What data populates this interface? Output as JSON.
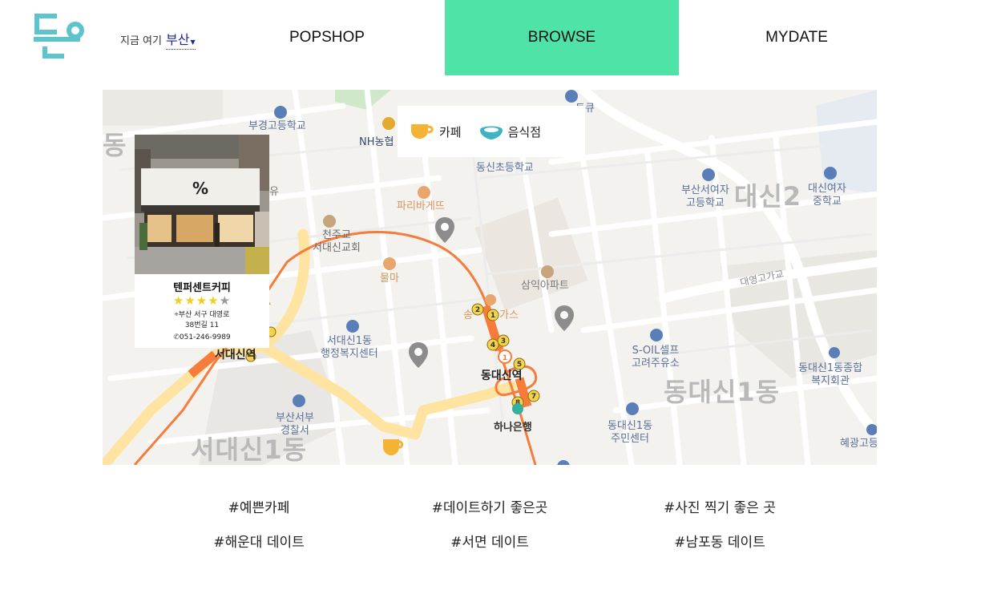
{
  "header": {
    "location_label": "지금 여기",
    "location_city": "부산",
    "nav": {
      "popshop": "POPSHOP",
      "browse": "BROWSE",
      "mydate": "MYDATE"
    },
    "active_tab": "BROWSE",
    "accent_color": "#4fe3a8",
    "logo_color": "#5cc4cc"
  },
  "map": {
    "legend": {
      "cafe": {
        "label": "카페",
        "icon": "coffee-cup-icon",
        "color": "#f5b335"
      },
      "restaurant": {
        "label": "음식점",
        "icon": "dish-icon",
        "color": "#3fb3c4"
      }
    },
    "labels": {
      "school_busan_girls": "부경고등학교",
      "nh": "NH농협",
      "dongsin_elem": "동신초등학교",
      "paris": "파리바게뜨",
      "catholic_1": "천주교",
      "catholic_2": "서대신교회",
      "mulma": "물마",
      "samik": "삼익아파트",
      "seodaesin_office_1": "서대신1동",
      "seodaesin_office_2": "행정복지센터",
      "police_1": "부산서부",
      "police_2": "경찰서",
      "hana": "하나은행",
      "soil_1": "S-OIL셀프",
      "soil_2": "고려주유소",
      "dongdaesin_center_1": "동대신1동",
      "dongdaesin_center_2": "주민센터",
      "busan_girls_1": "부산서여자",
      "busan_girls_2": "고등학교",
      "daesin_girls_1": "대신여자",
      "daesin_girls_2": "중학교",
      "complex_1": "동대신1동종합",
      "complex_2": "복지회관",
      "hyegwang": "혜광고등",
      "road_daeyeong": "대영고가교",
      "station_seodaesin": "서대신역",
      "station_dongdaesin": "동대신역",
      "district_daesin2": "대신2",
      "district_dongdaesin1": "동대신1동",
      "district_seodaesin1": "서대신1동",
      "district_dong": "동",
      "partial_yu": "유",
      "partial_transit": "트큐",
      "partial_song": "송",
      "partial_gas": "가스"
    },
    "exit_numbers": [
      "1",
      "2",
      "3",
      "4",
      "5",
      "7",
      "8"
    ],
    "station_line_badge": "1"
  },
  "place_card": {
    "name": "텐퍼센트커피",
    "rating": 4,
    "rating_max": 5,
    "stars_filled": "★★★★",
    "stars_empty": "★",
    "address_line1": "부산 서구 대영로",
    "address_line2": "38번길 11",
    "phone": "051-246-9989",
    "sign_text": "%"
  },
  "hashtags": [
    "#예쁜카페",
    "#데이트하기 좋은곳",
    "#사진 찍기 좋은 곳",
    "#해운대 데이트",
    "#서면 데이트",
    "#남포동 데이트"
  ]
}
